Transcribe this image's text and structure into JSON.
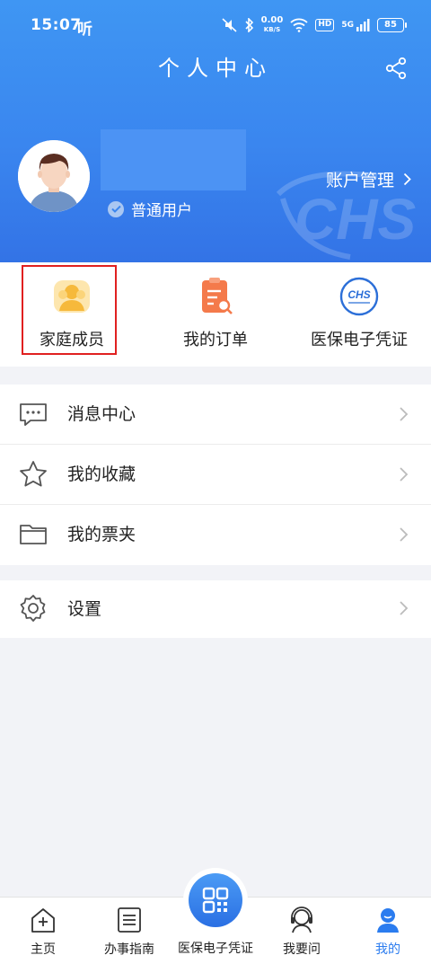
{
  "status_bar": {
    "time": "15:07",
    "app_indicator": "听",
    "net_speed_value": "0.00",
    "net_speed_unit": "KB/S",
    "hd": "HD",
    "signal": "5G",
    "battery": "85"
  },
  "header": {
    "title": "个人中心",
    "share_icon": "share-icon"
  },
  "profile": {
    "user_type": "普通用户",
    "account_management": "账户管理",
    "watermark_text": "CHS"
  },
  "quick_entries": [
    {
      "label": "家庭成员",
      "icon": "family-members-icon"
    },
    {
      "label": "我的订单",
      "icon": "orders-icon"
    },
    {
      "label": "医保电子凭证",
      "icon": "chs-logo-icon",
      "logo_text": "CHS"
    }
  ],
  "menu": {
    "group1": [
      {
        "label": "消息中心",
        "icon": "message-icon"
      },
      {
        "label": "我的收藏",
        "icon": "star-icon"
      },
      {
        "label": "我的票夹",
        "icon": "folder-icon"
      }
    ],
    "group2": [
      {
        "label": "设置",
        "icon": "gear-icon"
      }
    ]
  },
  "bottom_nav": {
    "items": [
      {
        "label": "主页",
        "icon": "home-icon"
      },
      {
        "label": "办事指南",
        "icon": "guide-icon"
      },
      {
        "label": "医保电子凭证",
        "icon": "qr-code-icon"
      },
      {
        "label": "我要问",
        "icon": "support-icon"
      },
      {
        "label": "我的",
        "icon": "profile-icon"
      }
    ],
    "active": "我的"
  },
  "colors": {
    "header_blue": "#3a86ef",
    "accent_blue": "#2b7cef",
    "highlight_red": "#e02020",
    "order_orange": "#f47a4b",
    "family_yellow": "#f6b93b"
  }
}
